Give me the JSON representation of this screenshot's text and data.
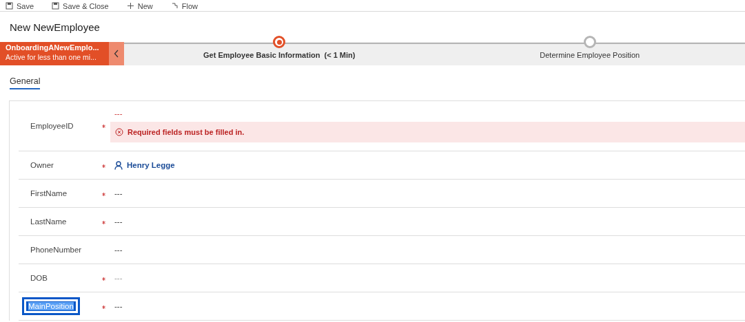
{
  "toolbar": [
    {
      "label": "Save",
      "kind": "save"
    },
    {
      "label": "Save & Close",
      "kind": "save"
    },
    {
      "label": "New",
      "kind": "new"
    },
    {
      "label": "Flow",
      "kind": "flow"
    }
  ],
  "title": "New NewEmployee",
  "process": {
    "name": "OnboardingANewEmplo...",
    "status": "Active for less than one mi...",
    "stages": [
      {
        "label": "Get Employee Basic Information",
        "duration": "(< 1 Min)",
        "selected": true
      },
      {
        "label": "Determine Employee Position",
        "selected": false
      }
    ]
  },
  "tabs": [
    {
      "label": "General",
      "selected": true
    }
  ],
  "fields": [
    {
      "label": "EmployeeID",
      "required": true,
      "kind": "text",
      "value": "---",
      "error": "Required fields must be filled in.",
      "selected": false
    },
    {
      "label": "Owner",
      "required": true,
      "kind": "lookup",
      "value": "Henry Legge",
      "selected": false
    },
    {
      "label": "FirstName",
      "required": true,
      "kind": "text",
      "value": "---",
      "selected": false
    },
    {
      "label": "LastName",
      "required": true,
      "kind": "text",
      "value": "---",
      "selected": false
    },
    {
      "label": "PhoneNumber",
      "required": false,
      "kind": "text",
      "value": "---",
      "selected": false
    },
    {
      "label": "DOB",
      "required": true,
      "kind": "text",
      "value": "---",
      "selected": false,
      "disabled": true
    },
    {
      "label": "MainPosition",
      "required": true,
      "kind": "text",
      "value": "---",
      "selected": true
    }
  ]
}
